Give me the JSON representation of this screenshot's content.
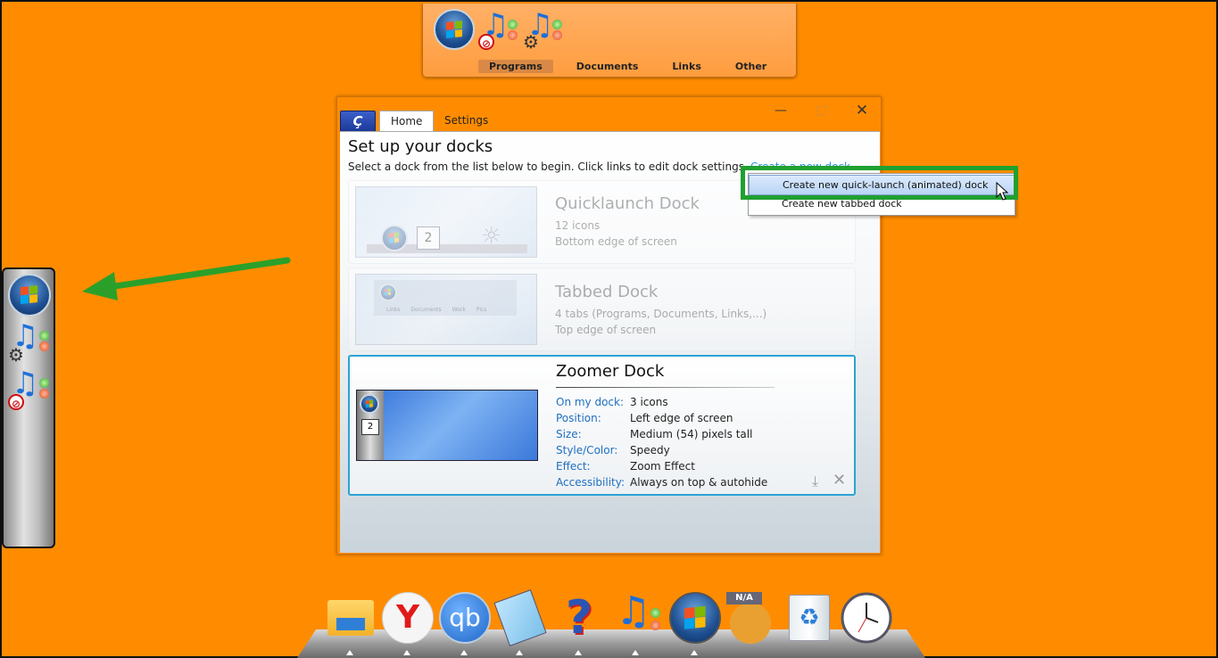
{
  "tabbed_dock": {
    "tabs": [
      "Programs",
      "Documents",
      "Links",
      "Other"
    ],
    "active_tab": "Programs"
  },
  "window": {
    "app_icon_glyph": "Ç",
    "tabs": {
      "home": "Home",
      "settings": "Settings"
    },
    "controls": {
      "minimize": "—",
      "maximize": "□",
      "close": "✕"
    },
    "title": "Set up your docks",
    "subtitle": "Select a dock from the list below to begin. Click links to edit dock settings.",
    "create_link": "Create a new dock",
    "docks": [
      {
        "name": "Quicklaunch Dock",
        "line1": "12 icons",
        "line2": "Bottom edge of screen"
      },
      {
        "name": "Tabbed Dock",
        "line1": "4 tabs (Programs, Documents, Links,...)",
        "line2": "Top edge of screen",
        "thumb_tabs": [
          "Links",
          "Documents",
          "Work",
          "Pics"
        ]
      },
      {
        "name": "Zoomer Dock",
        "details": [
          {
            "label": "On my dock:",
            "value": "3 icons"
          },
          {
            "label": "Position:",
            "value": "Left edge of screen"
          },
          {
            "label": "Size:",
            "value": "Medium (54) pixels tall"
          },
          {
            "label": "Style/Color:",
            "value": "Speedy"
          },
          {
            "label": "Effect:",
            "value": "Zoom Effect"
          },
          {
            "label": "Accessibility:",
            "value": "Always on top & autohide"
          }
        ]
      }
    ]
  },
  "menu": {
    "items": [
      "Create new quick-launch (animated) dock",
      "Create new tabbed dock"
    ],
    "highlighted_index": 0
  },
  "bottom_dock": {
    "icons": [
      "folder-icon",
      "yandex-browser-icon",
      "qbittorrent-icon",
      "notepad-icon",
      "help-icon",
      "music-app-icon",
      "windows-start-icon",
      "na-placeholder-icon",
      "recycle-bin-icon",
      "clock-icon"
    ],
    "qb_label": "qb",
    "na_label": "N/A"
  },
  "colors": {
    "desktop": "#ff8c00",
    "accent_link": "#2a8fd8",
    "highlight_green": "#20a030"
  }
}
